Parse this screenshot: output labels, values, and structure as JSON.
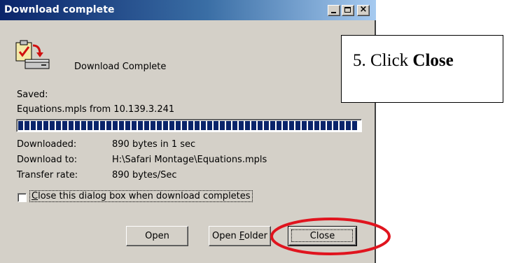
{
  "window": {
    "title": "Download complete",
    "title_gradient_start": "#0a246a",
    "title_gradient_end": "#a6caf0",
    "face_color": "#d4d0c8",
    "controls": {
      "minimize": "minimize-icon",
      "maximize": "maximize-icon",
      "close_glyph": "×"
    }
  },
  "dialog": {
    "icon": "download-complete-icon",
    "heading": "Download Complete",
    "saved_label": "Saved:",
    "file_line": "Equations.mpls from 10.139.3.241",
    "progress": 1.0,
    "progress_color": "#0a246a",
    "info": {
      "downloaded_label": "Downloaded:",
      "downloaded_value": "890 bytes in 1 sec",
      "download_to_label": "Download to:",
      "download_to_value": "H:\\Safari Montage\\Equations.mpls",
      "transfer_rate_label": "Transfer rate:",
      "transfer_rate_value": "890 bytes/Sec"
    },
    "close_when_complete_label": "Close this dialog box when download completes",
    "close_when_complete_checked": false
  },
  "buttons": {
    "open_label": "Open",
    "open_folder_label": "Open Folder",
    "close_label": "Close"
  },
  "annotation": {
    "step_text": "5. Click ",
    "step_bold": "Close",
    "highlight_color": "#e0141e"
  }
}
